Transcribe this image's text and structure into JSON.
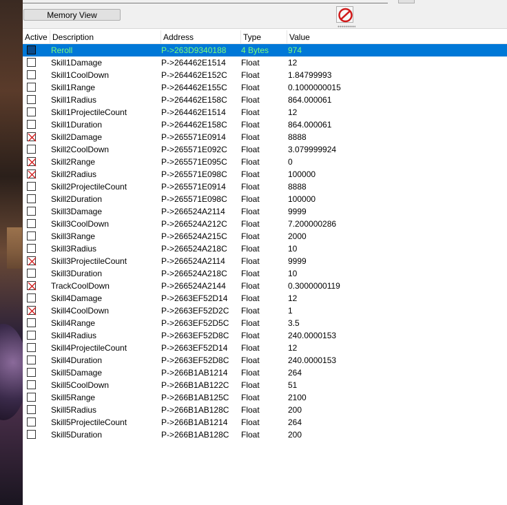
{
  "toolbar": {
    "memory_view_label": "Memory View",
    "stop_icon": "no-entry-icon"
  },
  "columns": {
    "active": "Active",
    "description": "Description",
    "address": "Address",
    "type": "Type",
    "value": "Value"
  },
  "colors": {
    "selected_row_bg": "#0078d7",
    "selected_row_text": "#7cfc7c",
    "checkbox_cross": "#d11a1a"
  },
  "entries": [
    {
      "active": false,
      "selected": true,
      "description": "Reroll",
      "address": "P->263D9340188",
      "type": "4 Bytes",
      "value": "974"
    },
    {
      "active": false,
      "selected": false,
      "description": "Skill1Damage",
      "address": "P->264462E1514",
      "type": "Float",
      "value": "12"
    },
    {
      "active": false,
      "selected": false,
      "description": "Skill1CoolDown",
      "address": "P->264462E152C",
      "type": "Float",
      "value": "1.84799993"
    },
    {
      "active": false,
      "selected": false,
      "description": "Skill1Range",
      "address": "P->264462E155C",
      "type": "Float",
      "value": "0.1000000015"
    },
    {
      "active": false,
      "selected": false,
      "description": "Skill1Radius",
      "address": "P->264462E158C",
      "type": "Float",
      "value": "864.000061"
    },
    {
      "active": false,
      "selected": false,
      "description": "Skill1ProjectileCount",
      "address": "P->264462E1514",
      "type": "Float",
      "value": "12"
    },
    {
      "active": false,
      "selected": false,
      "description": "Skill1Duration",
      "address": "P->264462E158C",
      "type": "Float",
      "value": "864.000061"
    },
    {
      "active": true,
      "selected": false,
      "description": "Skill2Damage",
      "address": "P->265571E0914",
      "type": "Float",
      "value": "8888"
    },
    {
      "active": false,
      "selected": false,
      "description": "Skill2CoolDown",
      "address": "P->265571E092C",
      "type": "Float",
      "value": "3.079999924"
    },
    {
      "active": true,
      "selected": false,
      "description": "Skill2Range",
      "address": "P->265571E095C",
      "type": "Float",
      "value": "0"
    },
    {
      "active": true,
      "selected": false,
      "description": "Skill2Radius",
      "address": "P->265571E098C",
      "type": "Float",
      "value": "100000"
    },
    {
      "active": false,
      "selected": false,
      "description": "Skill2ProjectileCount",
      "address": "P->265571E0914",
      "type": "Float",
      "value": "8888"
    },
    {
      "active": false,
      "selected": false,
      "description": "Skill2Duration",
      "address": "P->265571E098C",
      "type": "Float",
      "value": "100000"
    },
    {
      "active": false,
      "selected": false,
      "description": "Skill3Damage",
      "address": "P->266524A2114",
      "type": "Float",
      "value": "9999"
    },
    {
      "active": false,
      "selected": false,
      "description": "Skill3CoolDown",
      "address": "P->266524A212C",
      "type": "Float",
      "value": "7.200000286"
    },
    {
      "active": false,
      "selected": false,
      "description": "Skill3Range",
      "address": "P->266524A215C",
      "type": "Float",
      "value": "2000"
    },
    {
      "active": false,
      "selected": false,
      "description": "Skill3Radius",
      "address": "P->266524A218C",
      "type": "Float",
      "value": "10"
    },
    {
      "active": true,
      "selected": false,
      "description": "Skill3ProjectileCount",
      "address": "P->266524A2114",
      "type": "Float",
      "value": "9999"
    },
    {
      "active": false,
      "selected": false,
      "description": "Skill3Duration",
      "address": "P->266524A218C",
      "type": "Float",
      "value": "10"
    },
    {
      "active": true,
      "selected": false,
      "description": "TrackCoolDown",
      "address": "P->266524A2144",
      "type": "Float",
      "value": "0.3000000119"
    },
    {
      "active": false,
      "selected": false,
      "description": "Skill4Damage",
      "address": "P->2663EF52D14",
      "type": "Float",
      "value": "12"
    },
    {
      "active": true,
      "selected": false,
      "description": "Skill4CoolDown",
      "address": "P->2663EF52D2C",
      "type": "Float",
      "value": "1"
    },
    {
      "active": false,
      "selected": false,
      "description": "Skill4Range",
      "address": "P->2663EF52D5C",
      "type": "Float",
      "value": "3.5"
    },
    {
      "active": false,
      "selected": false,
      "description": "Skill4Radius",
      "address": "P->2663EF52D8C",
      "type": "Float",
      "value": "240.0000153"
    },
    {
      "active": false,
      "selected": false,
      "description": "Skill4ProjectileCount",
      "address": "P->2663EF52D14",
      "type": "Float",
      "value": "12"
    },
    {
      "active": false,
      "selected": false,
      "description": "Skill4Duration",
      "address": "P->2663EF52D8C",
      "type": "Float",
      "value": "240.0000153"
    },
    {
      "active": false,
      "selected": false,
      "description": "Skill5Damage",
      "address": "P->266B1AB1214",
      "type": "Float",
      "value": "264"
    },
    {
      "active": false,
      "selected": false,
      "description": "Skill5CoolDown",
      "address": "P->266B1AB122C",
      "type": "Float",
      "value": "51"
    },
    {
      "active": false,
      "selected": false,
      "description": "Skill5Range",
      "address": "P->266B1AB125C",
      "type": "Float",
      "value": "2100"
    },
    {
      "active": false,
      "selected": false,
      "description": "Skill5Radius",
      "address": "P->266B1AB128C",
      "type": "Float",
      "value": "200"
    },
    {
      "active": false,
      "selected": false,
      "description": "Skill5ProjectileCount",
      "address": "P->266B1AB1214",
      "type": "Float",
      "value": "264"
    },
    {
      "active": false,
      "selected": false,
      "description": "Skill5Duration",
      "address": "P->266B1AB128C",
      "type": "Float",
      "value": "200"
    }
  ]
}
